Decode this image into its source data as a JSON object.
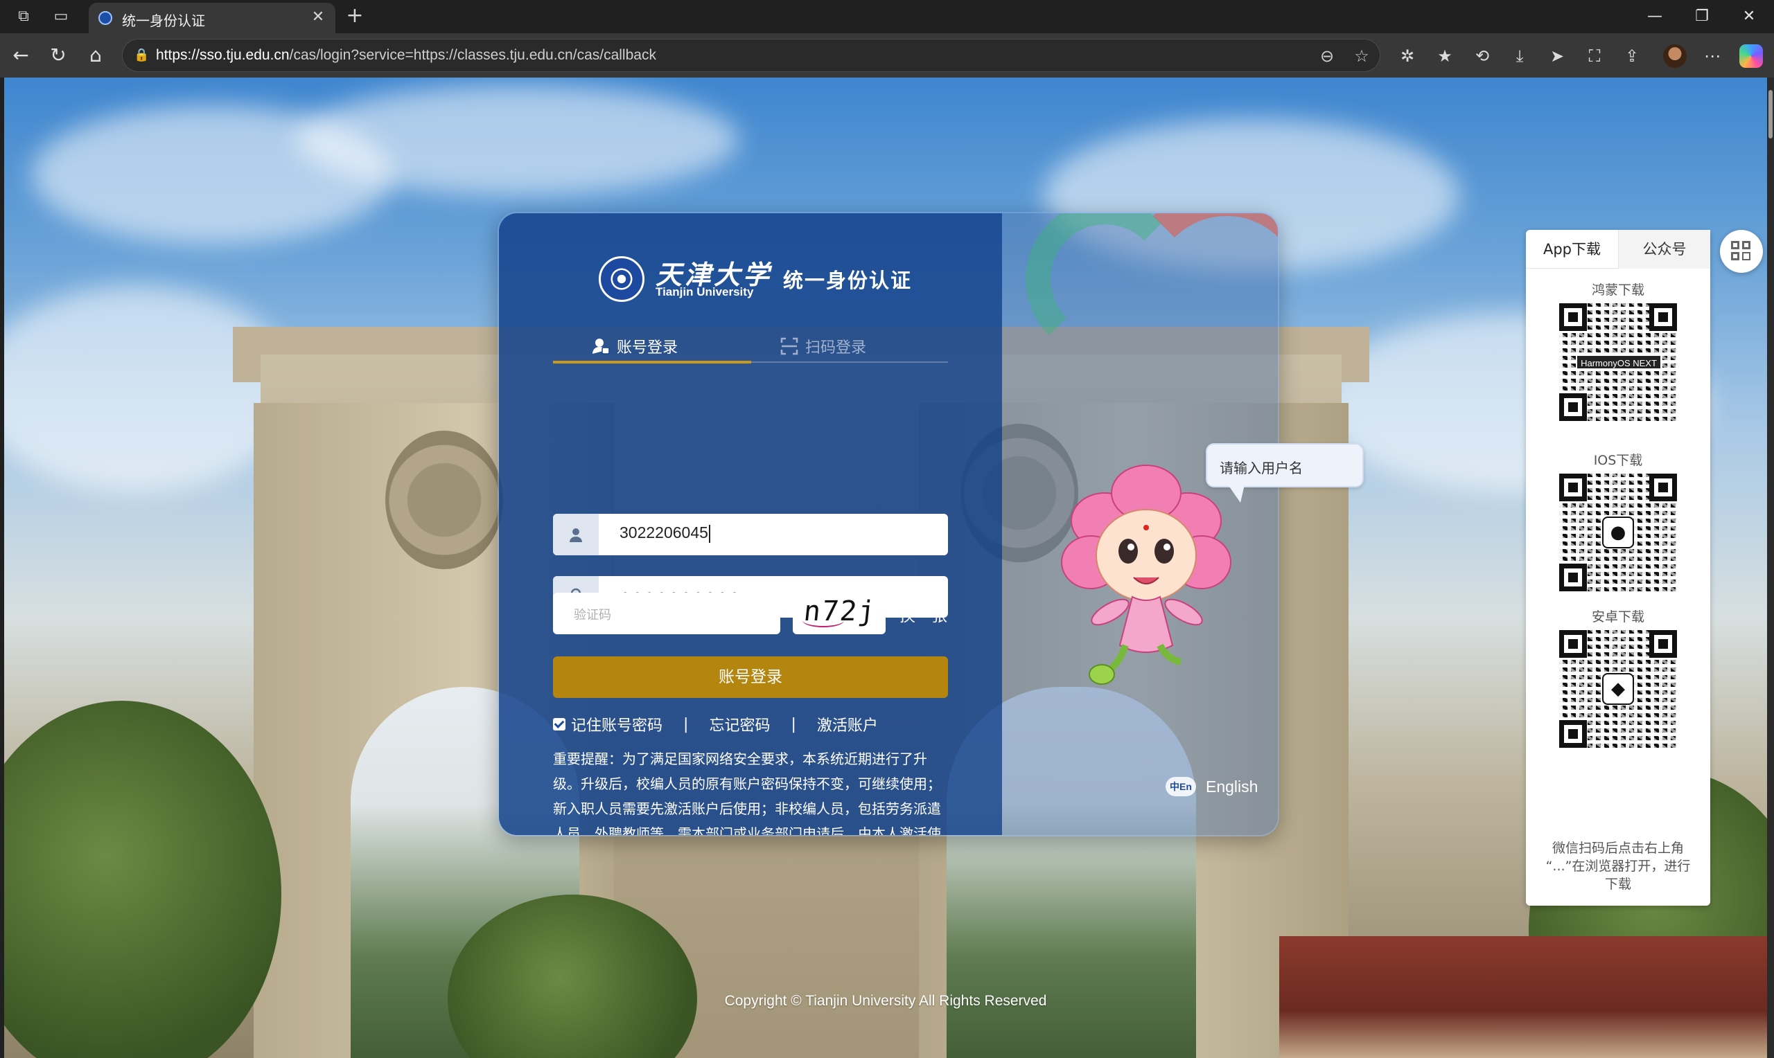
{
  "browser": {
    "tab_title": "统一身份认证",
    "url_host": "https://sso.tju.edu.cn",
    "url_path": "/cas/login?service=https://classes.tju.edu.cn/cas/callback"
  },
  "login": {
    "logo_cn": "天津大学",
    "logo_en": "Tianjin University",
    "title": "统一身份认证",
    "tab_account": "账号登录",
    "tab_qr": "扫码登录",
    "username_value": "3022206045",
    "password_mask": "••••••••••",
    "captcha_placeholder": "验证码",
    "captcha_text": "n72j",
    "captcha_refresh": "换一张",
    "submit_label": "账号登录",
    "remember_label": "记住账号密码",
    "forgot_label": "忘记密码",
    "activate_label": "激活账户",
    "separator": "|",
    "notice": "重要提醒：为了满足国家网络安全要求，本系统近期进行了升级。升级后，校编人员的原有账户密码保持不变，可继续使用；新入职人员需要先激活账户后使用；非校编人员，包括劳务派遣人员、外聘教师等，需本部门或业务部门申请后，由本人激活使用。",
    "lang_badge": "中En",
    "lang_label": "English"
  },
  "mascot": {
    "tip": "请输入用户名"
  },
  "download": {
    "tab_app": "App下载",
    "tab_official": "公众号",
    "harmony_label": "鸿蒙下载",
    "harmony_badge": "HarmonyOS NEXT",
    "ios_label": "IOS下载",
    "android_label": "安卓下载",
    "note": "微信扫码后点击右上角 “...”在浏览器打开，进行下载"
  },
  "footer": {
    "copyright": "Copyright © Tianjin University All Rights Reserved"
  },
  "colors": {
    "card_blue": "#14428c",
    "login_gold": "#b5860f",
    "tab_underline": "#c99a1a"
  }
}
